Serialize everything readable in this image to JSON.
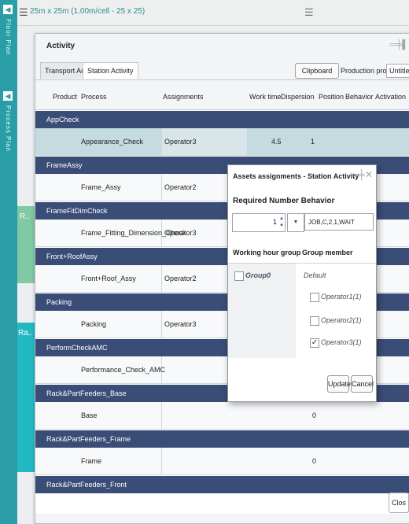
{
  "side_tabs": {
    "floor_plan": "Floor Plan",
    "process_plan": "Process Plan"
  },
  "topbar": {
    "title": "25m x 25m (1.00m/cell - 25 x 25)"
  },
  "background": {
    "label_r": "R..",
    "label_ra": "Ra.."
  },
  "window": {
    "title": "Activity",
    "tabs": [
      "Transport Activity",
      "Station Activity"
    ],
    "clipboard_label": "Clipboard text",
    "production_process_label": "Production process:",
    "production_process_value": "Untitled"
  },
  "table": {
    "columns": [
      "Product",
      "Process",
      "Assignments",
      "Work time",
      "Dispersion",
      "Position",
      "Behavior",
      "Activation"
    ],
    "groups": [
      {
        "name": "AppCheck",
        "rows": [
          {
            "process": "Appearance_Check",
            "assignment": "Operator3",
            "work_time": "4.5",
            "position": "1"
          }
        ]
      },
      {
        "name": "FrameAssy",
        "rows": [
          {
            "process": "Frame_Assy",
            "assignment": "Operator2",
            "work_time": "",
            "position": ""
          }
        ]
      },
      {
        "name": "FrameFitDimCheck",
        "rows": [
          {
            "process": "Frame_Fitting_Dimension_Check",
            "assignment": "Operator3",
            "work_time": "",
            "position": ""
          }
        ]
      },
      {
        "name": "Front+RoofAssy",
        "rows": [
          {
            "process": "Front+Roof_Assy",
            "assignment": "Operator2",
            "work_time": "",
            "position": ""
          }
        ]
      },
      {
        "name": "Packing",
        "rows": [
          {
            "process": "Packing",
            "assignment": "Operator3",
            "work_time": "",
            "position": ""
          }
        ]
      },
      {
        "name": "PerformCheckAMC",
        "rows": [
          {
            "process": "Performance_Check_AMC",
            "assignment": "",
            "work_time": "",
            "position": ""
          }
        ]
      },
      {
        "name": "Rack&PartFeeders_Base",
        "rows": [
          {
            "process": "Base",
            "assignment": "",
            "work_time": "",
            "position": "0"
          }
        ]
      },
      {
        "name": "Rack&PartFeeders_Frame",
        "rows": [
          {
            "process": "Frame",
            "assignment": "",
            "work_time": "",
            "position": "0"
          }
        ]
      },
      {
        "name": "Rack&PartFeeders_Front",
        "rows": []
      }
    ]
  },
  "close_label": "Clos",
  "popup": {
    "title": "Assets assignments - Station Activity",
    "section_title": "Required Number Behavior",
    "required_number": "1",
    "behavior_value": "JOB,C,2,1,WAIT",
    "col_group": "Working hour group",
    "col_member": "Group member",
    "group_name": "Group0",
    "default_label": "Default",
    "members": [
      {
        "name": "Operator1(1)",
        "checked": false
      },
      {
        "name": "Operator2(1)",
        "checked": false
      },
      {
        "name": "Operator3(1)",
        "checked": true
      }
    ],
    "update_label": "Update",
    "cancel_label": "Cancel"
  }
}
